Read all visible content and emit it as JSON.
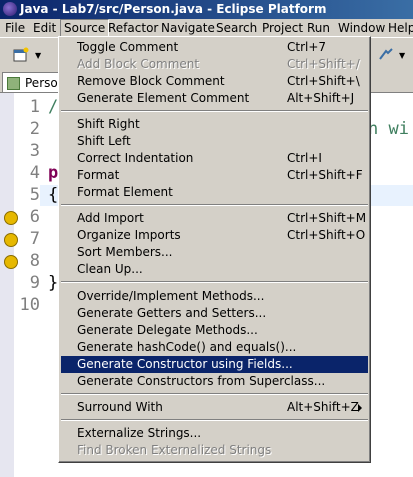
{
  "window": {
    "title": "Java - Lab7/src/Person.java - Eclipse Platform"
  },
  "menubar": [
    "File",
    "Edit",
    "Source",
    "Refactor",
    "Navigate",
    "Search",
    "Project",
    "Run",
    "Window",
    "Help"
  ],
  "editor": {
    "tab_label": "Person",
    "line_numbers": [
      "1",
      "2",
      "3",
      "4",
      "5",
      "6",
      "7",
      "8",
      "9",
      "10"
    ],
    "code_fragments": {
      "line1": "/",
      "line2": "n wi",
      "line4": "p",
      "line5": "{",
      "line9": "}"
    }
  },
  "source_menu": {
    "groups": [
      [
        {
          "label": "Toggle Comment",
          "shortcut": "Ctrl+7",
          "disabled": false
        },
        {
          "label": "Add Block Comment",
          "shortcut": "Ctrl+Shift+/",
          "disabled": true
        },
        {
          "label": "Remove Block Comment",
          "shortcut": "Ctrl+Shift+\\",
          "disabled": false
        },
        {
          "label": "Generate Element Comment",
          "shortcut": "Alt+Shift+J",
          "disabled": false
        }
      ],
      [
        {
          "label": "Shift Right",
          "shortcut": "",
          "disabled": false
        },
        {
          "label": "Shift Left",
          "shortcut": "",
          "disabled": false
        },
        {
          "label": "Correct Indentation",
          "shortcut": "Ctrl+I",
          "disabled": false
        },
        {
          "label": "Format",
          "shortcut": "Ctrl+Shift+F",
          "disabled": false
        },
        {
          "label": "Format Element",
          "shortcut": "",
          "disabled": false
        }
      ],
      [
        {
          "label": "Add Import",
          "shortcut": "Ctrl+Shift+M",
          "disabled": false
        },
        {
          "label": "Organize Imports",
          "shortcut": "Ctrl+Shift+O",
          "disabled": false
        },
        {
          "label": "Sort Members...",
          "shortcut": "",
          "disabled": false
        },
        {
          "label": "Clean Up...",
          "shortcut": "",
          "disabled": false
        }
      ],
      [
        {
          "label": "Override/Implement Methods...",
          "shortcut": "",
          "disabled": false
        },
        {
          "label": "Generate Getters and Setters...",
          "shortcut": "",
          "disabled": false
        },
        {
          "label": "Generate Delegate Methods...",
          "shortcut": "",
          "disabled": false
        },
        {
          "label": "Generate hashCode() and equals()...",
          "shortcut": "",
          "disabled": false
        },
        {
          "label": "Generate Constructor using Fields...",
          "shortcut": "",
          "disabled": false,
          "selected": true
        },
        {
          "label": "Generate Constructors from Superclass...",
          "shortcut": "",
          "disabled": false
        }
      ],
      [
        {
          "label": "Surround With",
          "shortcut": "Alt+Shift+Z",
          "disabled": false,
          "submenu": true
        }
      ],
      [
        {
          "label": "Externalize Strings...",
          "shortcut": "",
          "disabled": false
        },
        {
          "label": "Find Broken Externalized Strings",
          "shortcut": "",
          "disabled": true
        }
      ]
    ]
  },
  "colors": {
    "selection": "#0a246a",
    "menu_bg": "#d4d0c8",
    "comment": "#3f7f5f",
    "keyword": "#7f0055"
  }
}
